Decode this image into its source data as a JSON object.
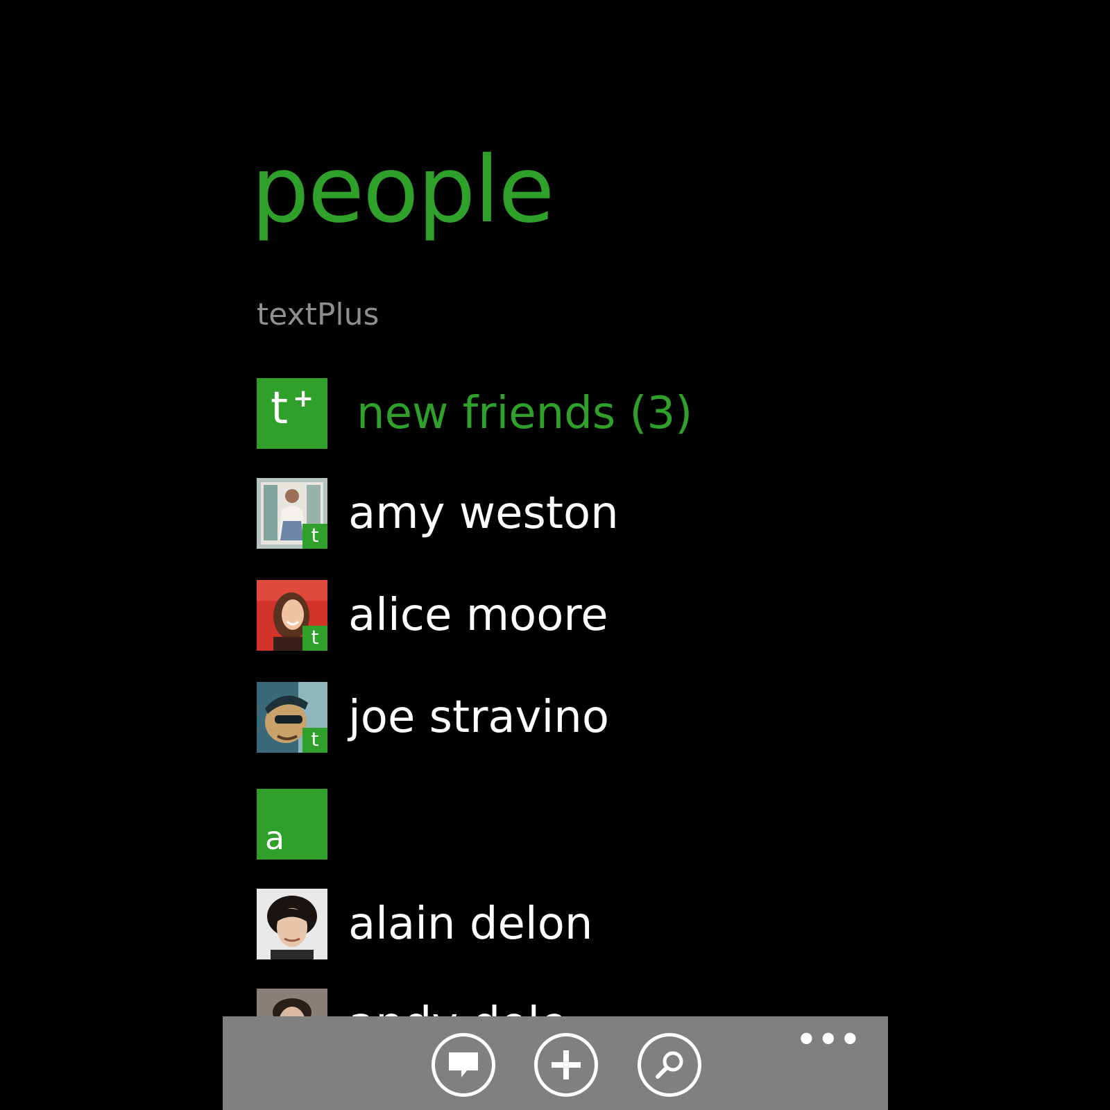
{
  "header": {
    "title": "people",
    "section": "textPlus"
  },
  "new_friends": {
    "tile_letter": "t",
    "tile_plus": "+",
    "label": "new friends (3)"
  },
  "contacts_top": [
    {
      "name": "amy weston",
      "badge": "t"
    },
    {
      "name": "alice moore",
      "badge": "t"
    },
    {
      "name": "joe stravino",
      "badge": "t"
    }
  ],
  "group": {
    "letter": "a"
  },
  "contacts_group": [
    {
      "name": "alain delon"
    },
    {
      "name": "andy dole"
    }
  ],
  "app_bar": {
    "more_label": "•••",
    "buttons": [
      {
        "icon": "chat-icon"
      },
      {
        "icon": "add-icon"
      },
      {
        "icon": "search-icon"
      }
    ]
  },
  "colors": {
    "accent": "#2fa02a",
    "background": "#000000",
    "app_bar": "#808080"
  }
}
